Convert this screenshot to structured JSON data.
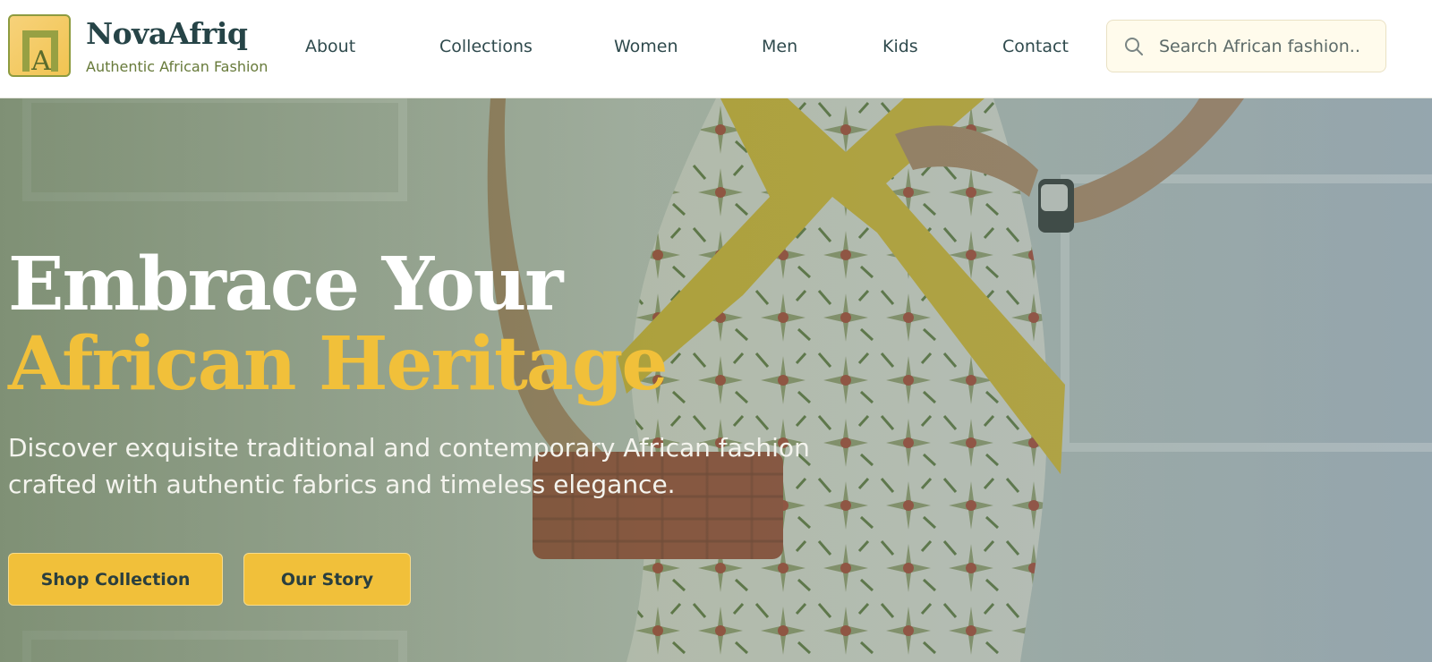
{
  "brand": {
    "name": "NovaAfriq",
    "tagline": "Authentic African Fashion",
    "logo_letter": "A"
  },
  "nav": {
    "items": [
      {
        "label": "About"
      },
      {
        "label": "Collections"
      },
      {
        "label": "Women"
      },
      {
        "label": "Men"
      },
      {
        "label": "Kids"
      },
      {
        "label": "Contact"
      }
    ]
  },
  "search": {
    "placeholder": "Search African fashion..",
    "value": "",
    "icon": "search-icon"
  },
  "hero": {
    "headline_line1": "Embrace Your",
    "headline_line2": "African Heritage",
    "description": "Discover exquisite traditional and contemporary African fashion crafted with authentic fabrics and timeless elegance.",
    "primary_button": "Shop Collection",
    "secondary_button": "Our Story"
  },
  "colors": {
    "accent_gold": "#f1c03a",
    "brand_teal": "#264447",
    "tagline_olive": "#677a3a",
    "search_bg": "#fffbec"
  }
}
